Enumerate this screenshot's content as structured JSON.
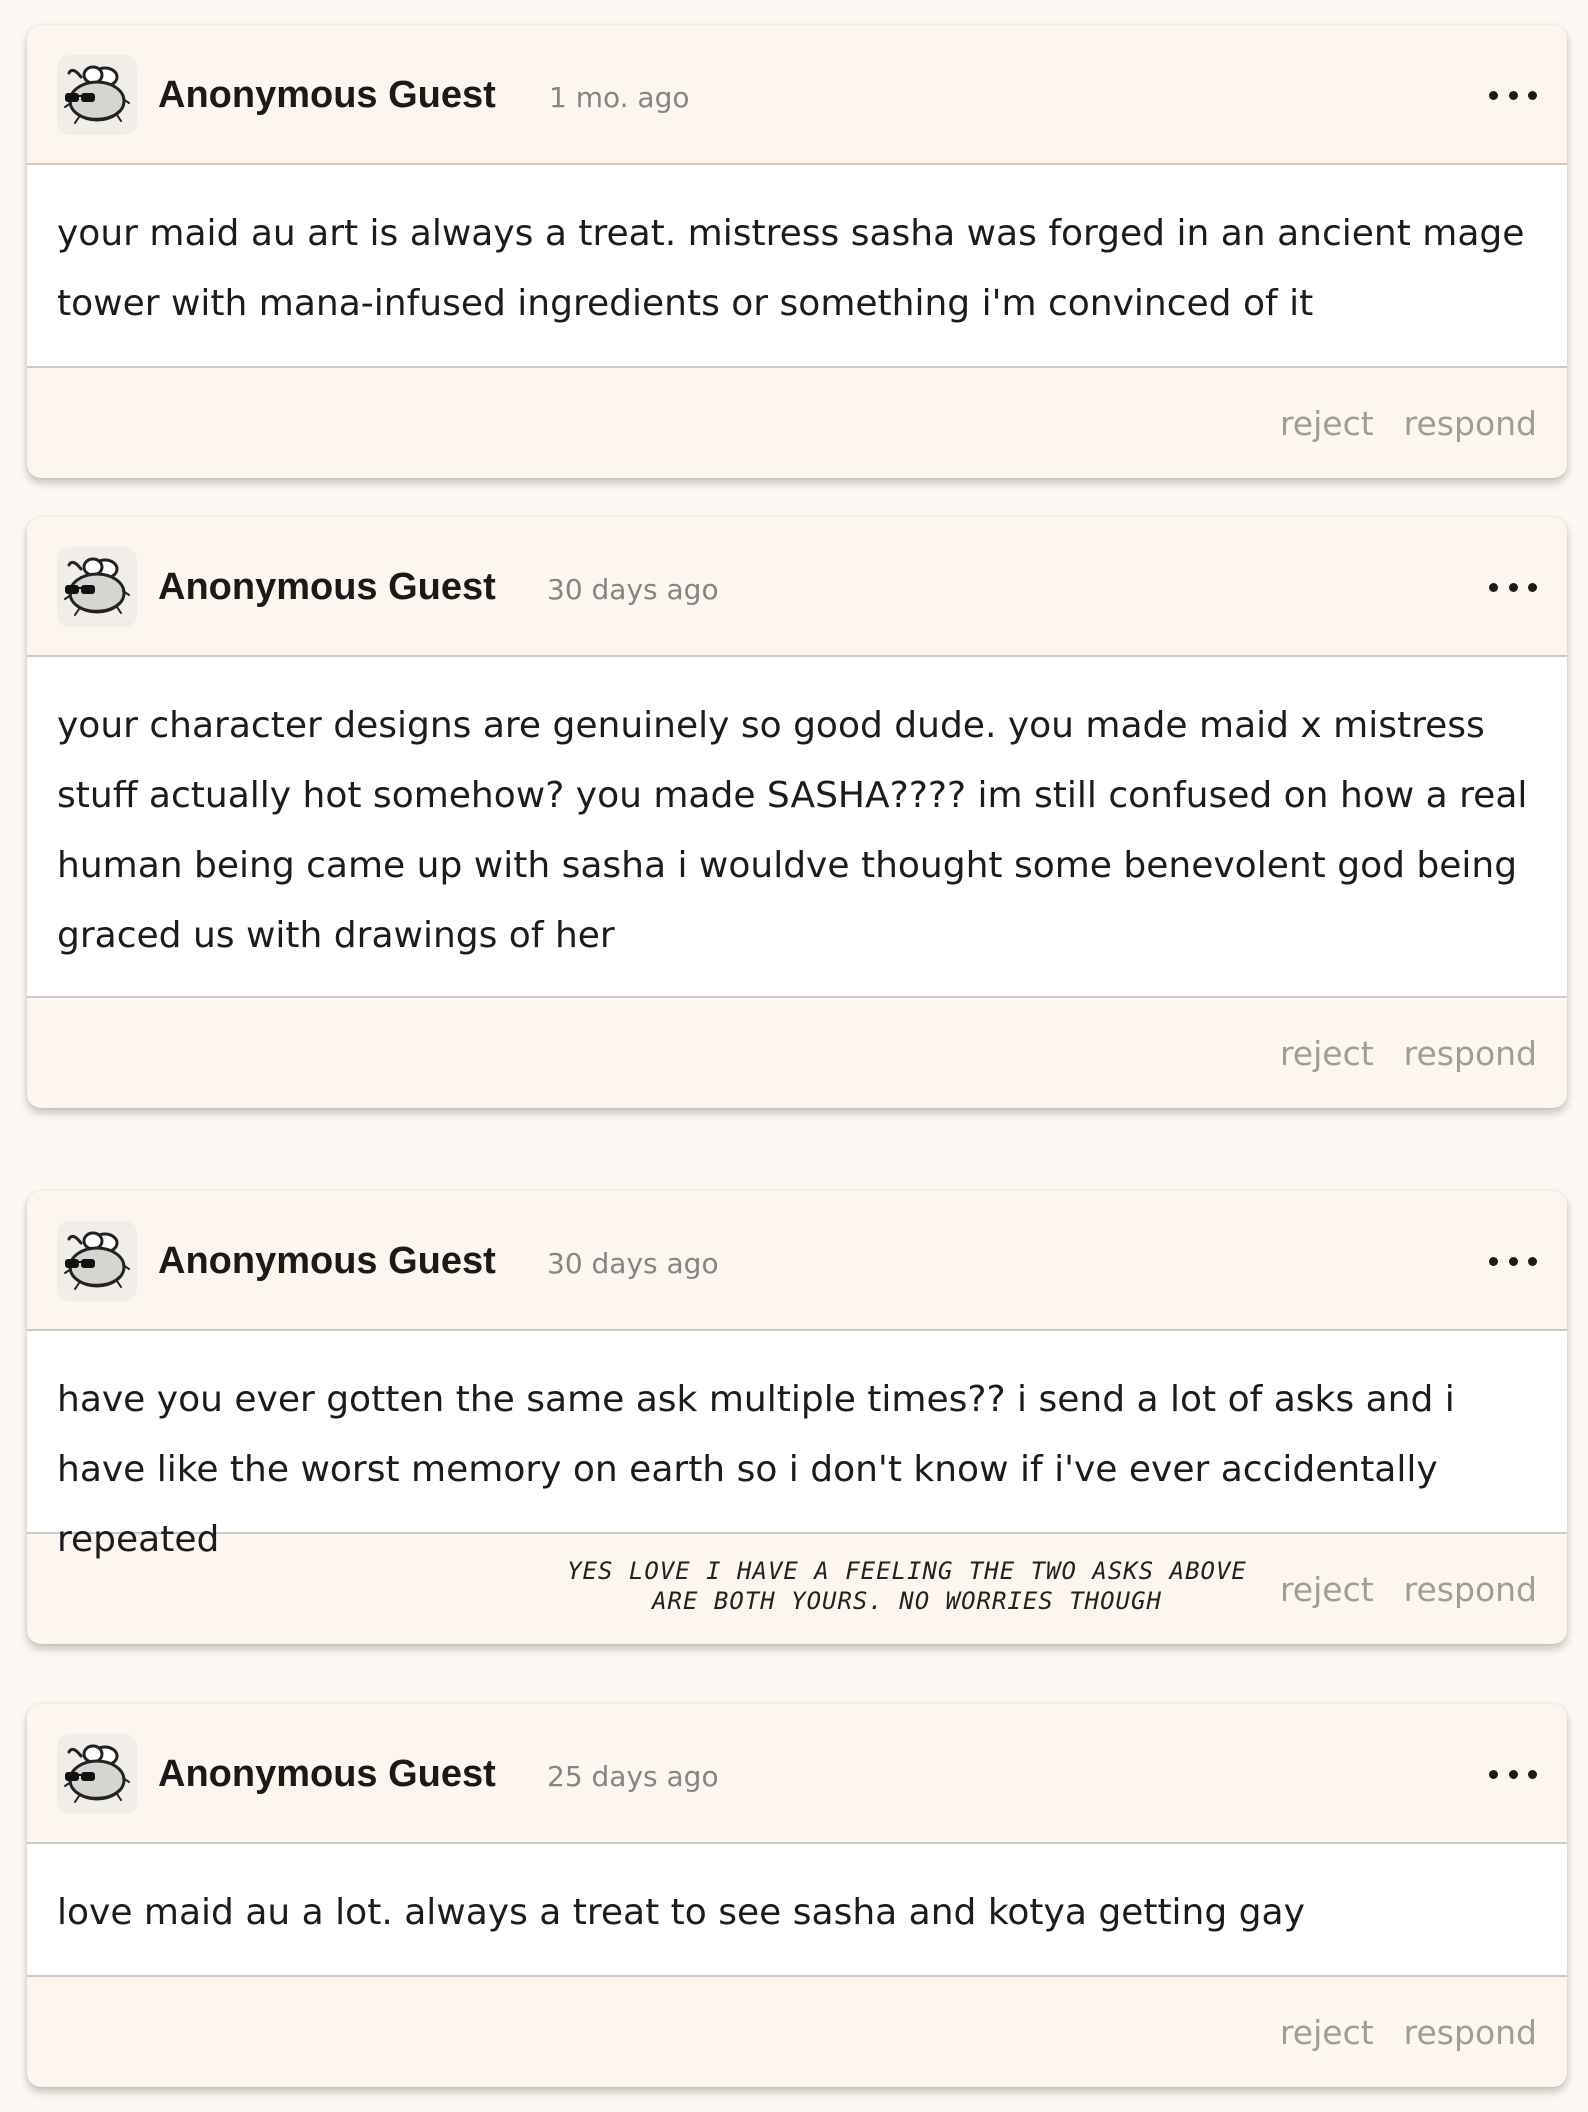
{
  "asks": [
    {
      "author": "Anonymous Guest",
      "timestamp": "1 mo. ago",
      "body": "your maid au art is always a treat. mistress sasha was forged in an ancient mage tower with mana-infused ingredients or something i'm convinced of it",
      "reject_label": "reject",
      "respond_label": "respond",
      "note": ""
    },
    {
      "author": "Anonymous Guest",
      "timestamp": "30 days ago",
      "body": "your character designs are genuinely so good dude. you made maid x mistress stuff actually hot somehow? you made SASHA???? im still confused on how a real human being came up with sasha i wouldve thought some benevolent god being graced us with drawings of her",
      "reject_label": "reject",
      "respond_label": "respond",
      "note": ""
    },
    {
      "author": "Anonymous Guest",
      "timestamp": "30 days ago",
      "body": "have you ever gotten the same ask multiple times?? i send a lot of asks and i have like the worst memory on earth so i don't know if i've ever accidentally repeated",
      "reject_label": "reject",
      "respond_label": "respond",
      "note": "yes love i have a feeling the two asks above are both yours. no worries though"
    },
    {
      "author": "Anonymous Guest",
      "timestamp": "25 days ago",
      "body": "love maid au a lot. always a treat to see sasha and kotya getting gay",
      "reject_label": "reject",
      "respond_label": "respond",
      "note": ""
    }
  ],
  "icons": {
    "avatar": "fly-with-sunglasses-icon",
    "more": "more-options-icon"
  }
}
